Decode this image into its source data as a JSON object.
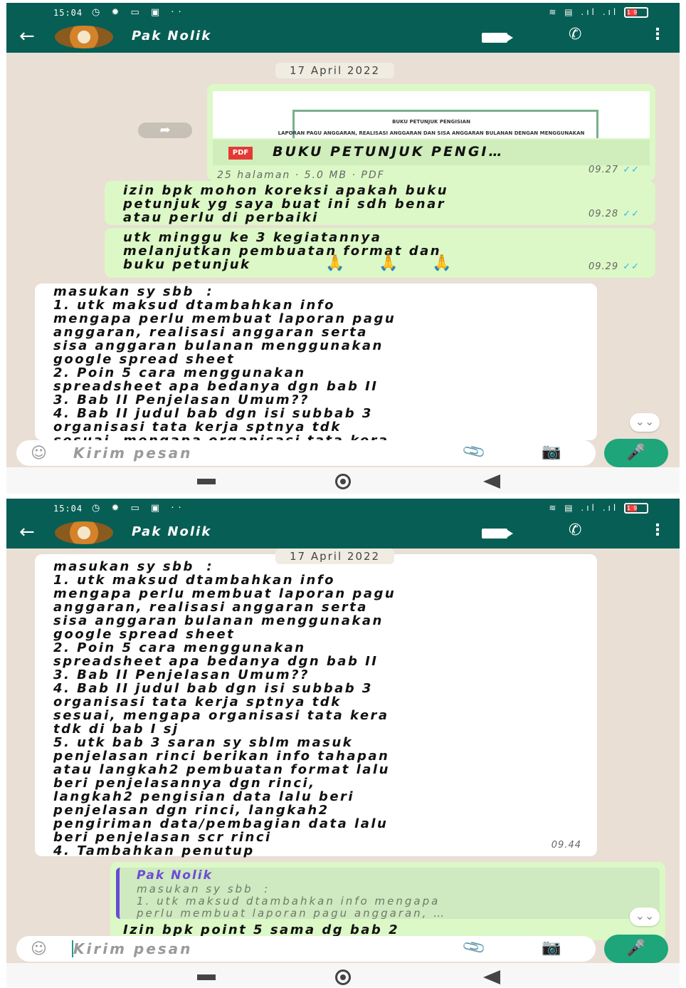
{
  "status": {
    "time": "15:04",
    "battery": "19"
  },
  "chat": {
    "contact_name": "Pak Nolik",
    "date_chip": "17 April 2022"
  },
  "document": {
    "preview_title": "BUKU PETUNJUK PENGISIAN",
    "preview_subtitle": "LAPORAN PAGU ANGGARAN, REALISASI ANGGARAN DAN SISA ANGGARAN BULANAN DENGAN MENGGUNAKAN",
    "badge": "PDF",
    "name": "BUKU PETUNJUK PENGI…",
    "info": "25 halaman · 5.0 MB · PDF",
    "time": "09.27"
  },
  "messages": {
    "m1": {
      "text": "izin bpk mohon koreksi apakah buku\npetunjuk yg saya buat ini sdh benar\natau perlu di perbaiki",
      "time": "09.28"
    },
    "m2": {
      "text": "utk minggu ke 3 kegiatannya\nmelanjutkan pembuatan format dan\nbuku petunjuk",
      "emoji": "🙏 🙏 🙏",
      "time": "09.29"
    },
    "m3_partial": "masukan sy sbb  :\n1. utk maksud dtambahkan info\nmengapa perlu membuat laporan pagu\nanggaran, realisasi anggaran serta\nsisa anggaran bulanan menggunakan\ngoogle spread sheet\n2. Poin 5 cara menggunakan\nspreadsheet apa bedanya dgn bab II\n3. Bab II Penjelasan Umum??\n4. Bab II judul bab dgn isi subbab 3\norganisasi tata kerja sptnya tdk\nsesuai, mengapa organisasi tata kera",
    "m3_full": "masukan sy sbb  :\n1. utk maksud dtambahkan info\nmengapa perlu membuat laporan pagu\nanggaran, realisasi anggaran serta\nsisa anggaran bulanan menggunakan\ngoogle spread sheet\n2. Poin 5 cara menggunakan\nspreadsheet apa bedanya dgn bab II\n3. Bab II Penjelasan Umum??\n4. Bab II judul bab dgn isi subbab 3\norganisasi tata kerja sptnya tdk\nsesuai, mengapa organisasi tata kera\ntdk di bab I sj\n5. utk bab 3 saran sy sblm masuk\npenjelasan rinci berikan info tahapan\natau langkah2 pembuatan format lalu\nberi penjelasannya dgn rinci,\nlangkah2 pengisian data lalu beri\npenjelasan dgn rinci, langkah2\npengiriman data/pembagian data lalu\nberi penjelasan scr rinci\n4. Tambahkan penutup",
    "m3_time": "09.44",
    "reply": {
      "quoted_name": "Pak Nolik",
      "quoted_text": "masukan sy sbb  :\n1. utk maksud dtambahkan info mengapa\nperlu membuat laporan pagu anggaran, …",
      "text": "Izin bpk point 5 sama dg bab 2"
    }
  },
  "input": {
    "placeholder": "Kirim pesan"
  },
  "icons": {
    "back": "back-arrow-icon",
    "video": "video-call-icon",
    "call": "phone-icon",
    "more": "more-vert-icon",
    "emoji": "emoji-icon",
    "attach": "paperclip-icon",
    "camera": "camera-icon",
    "mic": "mic-icon",
    "forward": "forward-icon"
  },
  "colors": {
    "header": "#075e54",
    "outgoing": "#dcf8c6",
    "incoming": "#ffffff",
    "wallpaper": "#e9dfd4",
    "mic": "#1ea57a",
    "read_ticks": "#34b7f1"
  }
}
